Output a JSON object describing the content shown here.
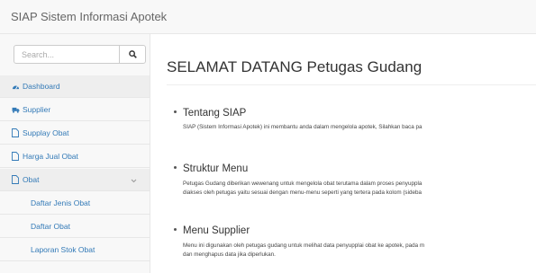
{
  "navbar": {
    "brand": "SIAP Sistem Informasi Apotek"
  },
  "sidebar": {
    "search": {
      "placeholder": "Search...",
      "value": ""
    },
    "items": [
      {
        "label": "Dashboard",
        "icon": "dashboard-icon"
      },
      {
        "label": "Supplier",
        "icon": "truck-icon"
      },
      {
        "label": "Supplay Obat",
        "icon": "file-icon"
      },
      {
        "label": "Harga Jual Obat",
        "icon": "file-icon"
      },
      {
        "label": "Obat",
        "icon": "file-icon",
        "expanded": true
      },
      {
        "label": "Daftar Jenis Obat"
      },
      {
        "label": "Daftar Obat"
      },
      {
        "label": "Laporan Stok Obat"
      }
    ]
  },
  "main": {
    "title": "SELAMAT DATANG Petugas Gudang",
    "sections": [
      {
        "heading": "Tentang SIAP",
        "lines": [
          "SIAP (Sistem Informasi Apotek) ini membantu anda dalam mengelola apotek, Silahkan baca pa"
        ]
      },
      {
        "heading": "Struktur Menu",
        "lines": [
          "Petugas Gudang diberikan wewenang untuk mengelola obat terutama dalam proses penyuppla",
          "diakses oleh petugas yaitu sesuai dengan menu-menu seperti yang tertera pada kolom (sideba"
        ]
      },
      {
        "heading": "Menu Supplier",
        "lines": [
          "Menu ini digunakan oleh petugas gudang untuk melihat data penyupplai obat ke apotek, pada m",
          "dan menghapus data jika diperlukan."
        ]
      }
    ]
  },
  "colors": {
    "link": "#337ab7",
    "navbar_bg": "#f8f8f8",
    "active_bg": "#eeeeee"
  }
}
